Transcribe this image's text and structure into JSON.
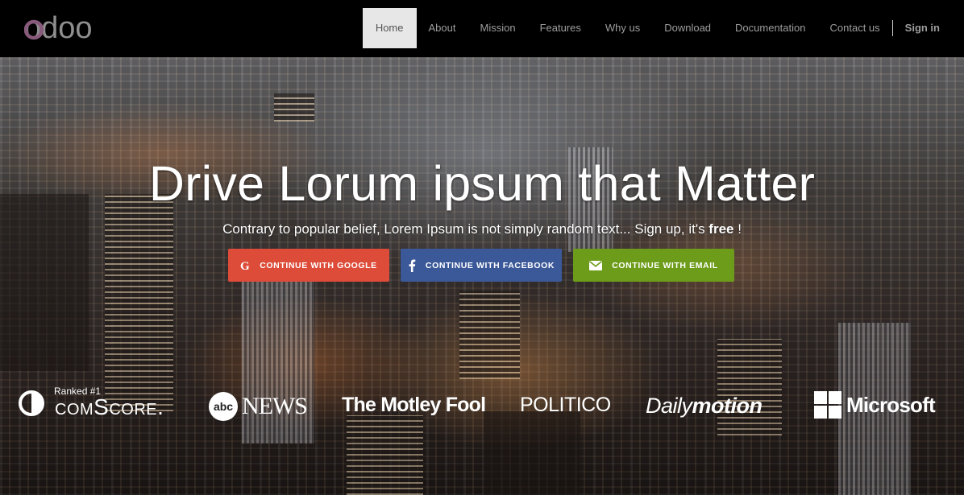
{
  "brand": {
    "logo_text": "odoo"
  },
  "nav": {
    "items": [
      {
        "label": "Home",
        "active": true
      },
      {
        "label": "About"
      },
      {
        "label": "Mission"
      },
      {
        "label": "Features"
      },
      {
        "label": "Why us"
      },
      {
        "label": "Download"
      },
      {
        "label": "Documentation"
      },
      {
        "label": "Contact us"
      }
    ],
    "signin_label": "Sign in"
  },
  "hero": {
    "title": "Drive Lorum ipsum that Matter",
    "subtitle_pre": "Contrary to popular belief, Lorem Ipsum is not simply random text... Sign up, it's ",
    "subtitle_bold": "free",
    "subtitle_post": " !",
    "buttons": [
      {
        "label": "Continue with Google",
        "icon": "google-icon",
        "color": "#dd4b39"
      },
      {
        "label": "Continue with Facebook",
        "icon": "facebook-icon",
        "color": "#3b5998"
      },
      {
        "label": "Continue with Email",
        "icon": "email-icon",
        "color": "#6c9c19"
      }
    ]
  },
  "press": {
    "comscore_ranked": "Ranked #1",
    "comscore": "comScore.",
    "abc_badge": "abc",
    "abc_news": "NEWS",
    "motley": "The Motley Fool",
    "politico": "POLITICO",
    "dailymotion_pre": "Daily",
    "dailymotion_post": "motion",
    "microsoft": "Microsoft"
  },
  "colors": {
    "logo_o1": "#875a7b",
    "logo_rest": "#8f8f8f",
    "nav_bg": "#000000",
    "active_tab_bg": "#e7e7e7"
  }
}
